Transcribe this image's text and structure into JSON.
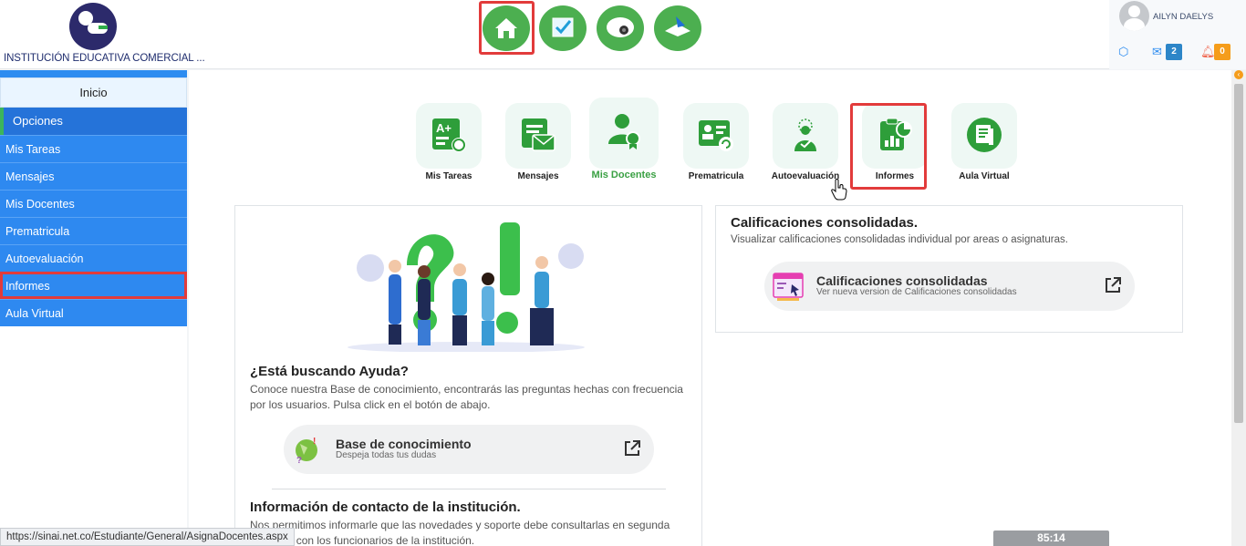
{
  "header": {
    "institution_name": "INSTITUCIÓN EDUCATIVA COMERCIAL ...",
    "user_name": "AILYN DAELYS",
    "messages_count": "2",
    "notifications_count": "0"
  },
  "sidebar": {
    "inicio": "Inicio",
    "opciones": "Opciones",
    "items": [
      {
        "label": "Mis Tareas"
      },
      {
        "label": "Mensajes"
      },
      {
        "label": "Mis Docentes"
      },
      {
        "label": "Prematricula"
      },
      {
        "label": "Autoevaluación"
      },
      {
        "label": "Informes"
      },
      {
        "label": "Aula Virtual"
      }
    ]
  },
  "tiles": [
    {
      "label": "Mis Tareas"
    },
    {
      "label": "Mensajes"
    },
    {
      "label": "Mis Docentes"
    },
    {
      "label": "Prematricula"
    },
    {
      "label": "Autoevaluación"
    },
    {
      "label": "Informes"
    },
    {
      "label": "Aula Virtual"
    }
  ],
  "help": {
    "title": "¿Está buscando Ayuda?",
    "description": "Conoce nuestra Base de conocimiento, encontrarás las preguntas hechas con frecuencia por los usuarios. Pulsa click en el botón de abajo.",
    "kb_title": "Base de conocimiento",
    "kb_subtitle": "Despeja todas tus dudas"
  },
  "contact": {
    "title": "Información de contacto de la institución.",
    "description": "Nos permitimos informarle que las novedades y soporte debe consultarlas en segunda instancia con los funcionarios de la institución."
  },
  "calificaciones": {
    "title": "Calificaciones consolidadas.",
    "description": "Visualizar calificaciones consolidadas individual por areas o asignaturas.",
    "button_title": "Calificaciones consolidadas",
    "button_subtitle": "Ver nueva version de Calificaciones consolidadas"
  },
  "status_url": "https://sinai.net.co/Estudiante/General/AsignaDocentes.aspx",
  "timer": "85:14",
  "colors": {
    "accent_green": "#4caf50",
    "sidebar_blue": "#2e89f0",
    "highlight_red": "#e23b3b"
  }
}
